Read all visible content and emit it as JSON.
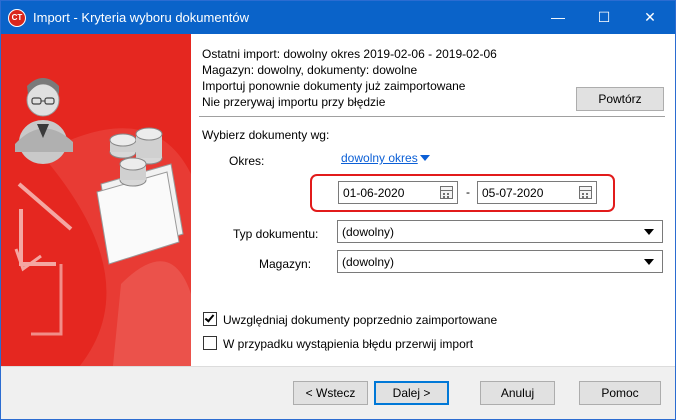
{
  "window": {
    "title": "Import - Kryteria wyboru dokumentów",
    "app_icon_text": "CT",
    "controls": {
      "minimize": "—",
      "maximize": "☐",
      "close": "✕"
    }
  },
  "info": {
    "line1": "Ostatni import: dowolny okres 2019-02-06 - 2019-02-06",
    "line2": "Magazyn: dowolny, dokumenty: dowolne",
    "line3": "Importuj ponownie dokumenty już zaimportowane",
    "line4": "Nie przerywaj importu przy błędzie",
    "repeat_button": "Powtórz"
  },
  "criteria": {
    "heading": "Wybierz dokumenty wg:",
    "period_label": "Okres:",
    "period_value": "dowolny okres",
    "date_from": "01-06-2020",
    "date_separator": "-",
    "date_to": "05-07-2020",
    "doc_type_label": "Typ dokumentu:",
    "doc_type_value": "(dowolny)",
    "warehouse_label": "Magazyn:",
    "warehouse_value": "(dowolny)"
  },
  "options": {
    "include_imported": {
      "label": "Uwzględniaj dokumenty poprzednio zaimportowane",
      "checked": true
    },
    "stop_on_error": {
      "label": "W przypadku wystąpienia błędu przerwij import",
      "checked": false
    }
  },
  "footer": {
    "back": "< Wstecz",
    "next": "Dalej >",
    "cancel": "Anuluj",
    "help": "Pomoc"
  },
  "colors": {
    "titlebar": "#0a63c9",
    "sidebar": "#e52720",
    "link": "#0b5fd6",
    "highlight": "#e21b1b"
  }
}
